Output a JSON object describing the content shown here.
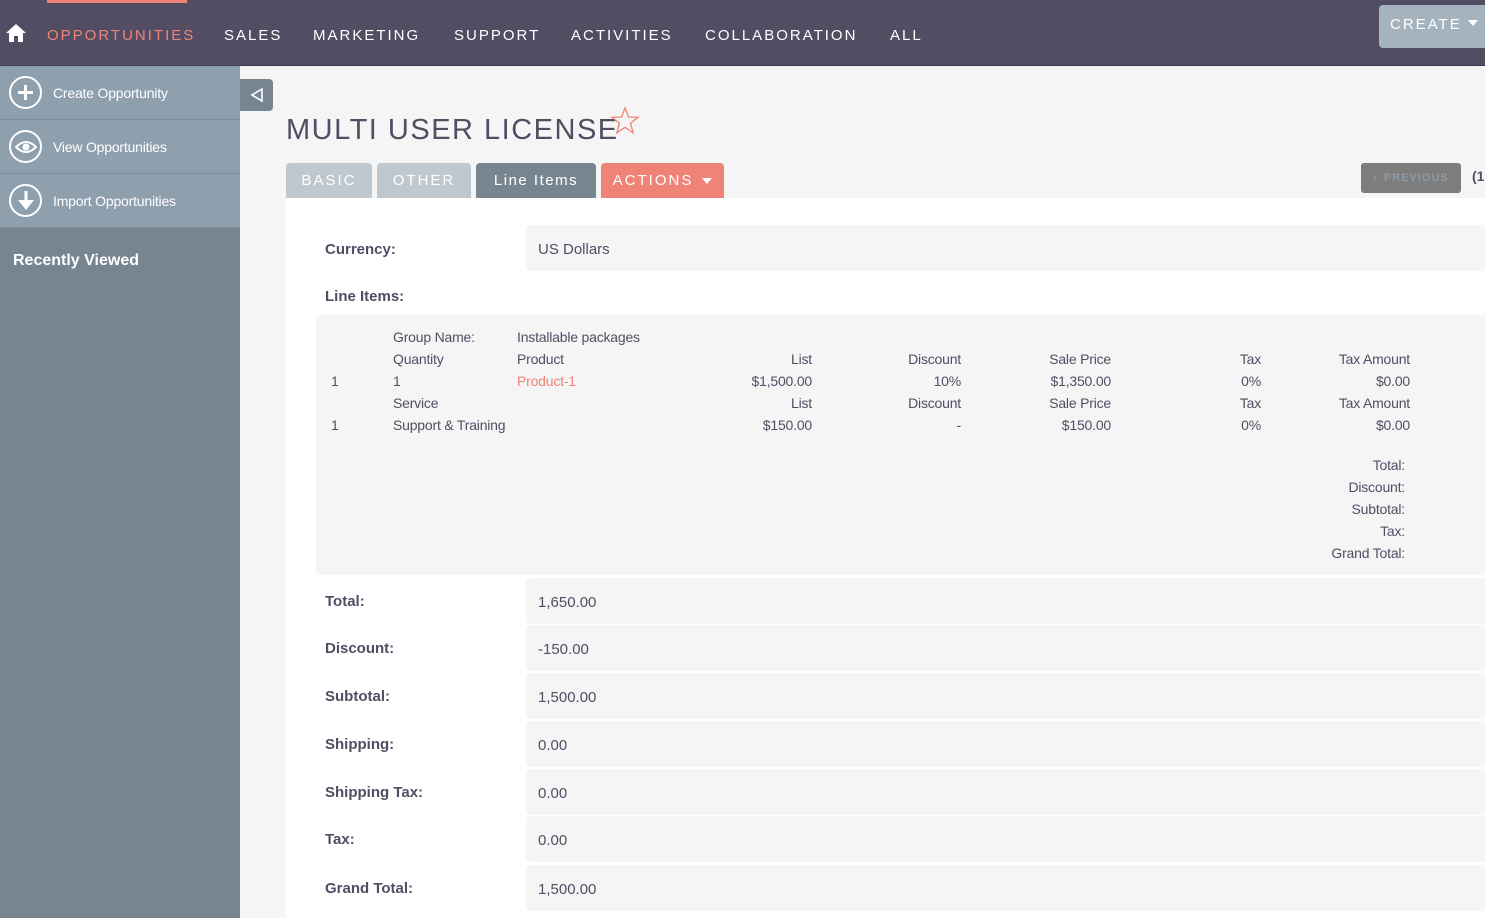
{
  "topnav": {
    "items": [
      {
        "label": "OPPORTUNITIES",
        "active": true
      },
      {
        "label": "SALES"
      },
      {
        "label": "MARKETING"
      },
      {
        "label": "SUPPORT"
      },
      {
        "label": "ACTIVITIES"
      },
      {
        "label": "COLLABORATION"
      },
      {
        "label": "ALL"
      }
    ],
    "create_label": "CREATE"
  },
  "sidebar": {
    "actions": [
      {
        "label": "Create Opportunity",
        "icon": "plus-circle-icon"
      },
      {
        "label": "View Opportunities",
        "icon": "eye-icon"
      },
      {
        "label": "Import Opportunities",
        "icon": "download-arrow-icon"
      }
    ],
    "recently_viewed_label": "Recently Viewed"
  },
  "record": {
    "title": "MULTI USER LICENSE",
    "tabs": [
      "BASIC",
      "OTHER",
      "Line Items"
    ],
    "actions_label": "ACTIONS",
    "previous_label": "PREVIOUS",
    "page_indicator": "(1"
  },
  "fields": {
    "currency_label": "Currency:",
    "currency_value": "US Dollars",
    "line_items_label": "Line Items:"
  },
  "line_items": {
    "group_name_label": "Group Name:",
    "group_name": "Installable packages",
    "product_headers": {
      "quantity": "Quantity",
      "product": "Product",
      "list": "List",
      "discount": "Discount",
      "sale_price": "Sale Price",
      "tax": "Tax",
      "tax_amount": "Tax Amount"
    },
    "product_row": {
      "index": "1",
      "quantity": "1",
      "product": "Product-1",
      "list": "$1,500.00",
      "discount": "10%",
      "sale_price": "$1,350.00",
      "tax": "0%",
      "tax_amount": "$0.00"
    },
    "service_headers": {
      "service": "Service",
      "list": "List",
      "discount": "Discount",
      "sale_price": "Sale Price",
      "tax": "Tax",
      "tax_amount": "Tax Amount"
    },
    "service_row": {
      "index": "1",
      "service": "Support & Training",
      "list": "$150.00",
      "discount": "-",
      "sale_price": "$150.00",
      "tax": "0%",
      "tax_amount": "$0.00"
    },
    "group_totals": [
      "Total:",
      "Discount:",
      "Subtotal:",
      "Tax:",
      "Grand Total:"
    ]
  },
  "totals": [
    {
      "label": "Total:",
      "value": "1,650.00"
    },
    {
      "label": "Discount:",
      "value": "-150.00"
    },
    {
      "label": "Subtotal:",
      "value": "1,500.00"
    },
    {
      "label": "Shipping:",
      "value": "0.00"
    },
    {
      "label": "Shipping Tax:",
      "value": "0.00"
    },
    {
      "label": "Tax:",
      "value": "0.00"
    },
    {
      "label": "Grand Total:",
      "value": "1,500.00"
    }
  ],
  "colors": {
    "nav_bg": "#534d64",
    "accent": "#f08377",
    "sidebar_bg": "#778591",
    "sidebar_action_bg": "#8e9fae"
  }
}
